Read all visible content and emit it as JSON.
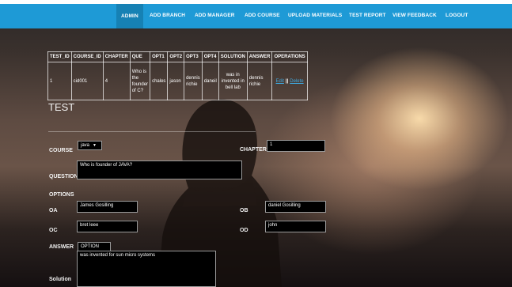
{
  "nav": {
    "items": [
      "ADMIN",
      "ADD BRANCH",
      "ADD MANAGER",
      "ADD COURSE",
      "UPLOAD MATERIALS",
      "TEST REPORT",
      "VIEW FEEDBACK",
      "LOGOUT"
    ],
    "active": "ADMIN",
    "color": "#1e9ad6"
  },
  "table": {
    "headers": [
      "TEST_ID",
      "COURSE_ID",
      "CHAPTER",
      "QUE",
      "OPT1",
      "OPT2",
      "OPT3",
      "OPT4",
      "SOLUTION",
      "ANSWER",
      "OPERATIONS"
    ],
    "row": {
      "test_id": "1",
      "course_id": "cid001",
      "chapter": "4",
      "que": "Who is the founder of C?",
      "opt1": "chales",
      "opt2": "jason",
      "opt3": "dennis richie",
      "opt4": "daneil",
      "solution": "was in invented in bell lab",
      "answer": "dennis richie",
      "op_edit": "Edit",
      "op_separator": "||",
      "op_delete": "Delete"
    }
  },
  "form": {
    "title": "TEST",
    "course_label": "COURSE",
    "course_value": "java",
    "chapter_label": "CHAPTER",
    "chapter_value": "1",
    "question_label": "QUESTION",
    "question_value": "Who is founder of JAVA?",
    "options_label": "OPTIONS",
    "oa_label": "OA",
    "oa_value": "James Gosilling",
    "ob_label": "OB",
    "ob_value": "daniel Gosilling",
    "oc_label": "OC",
    "oc_value": "bret leee",
    "od_label": "OD",
    "od_value": "john",
    "answer_label": "ANSWER",
    "answer_value": "OPTION A",
    "solution_label": "Solution",
    "solution_value": "was invented for sun micro systems"
  }
}
